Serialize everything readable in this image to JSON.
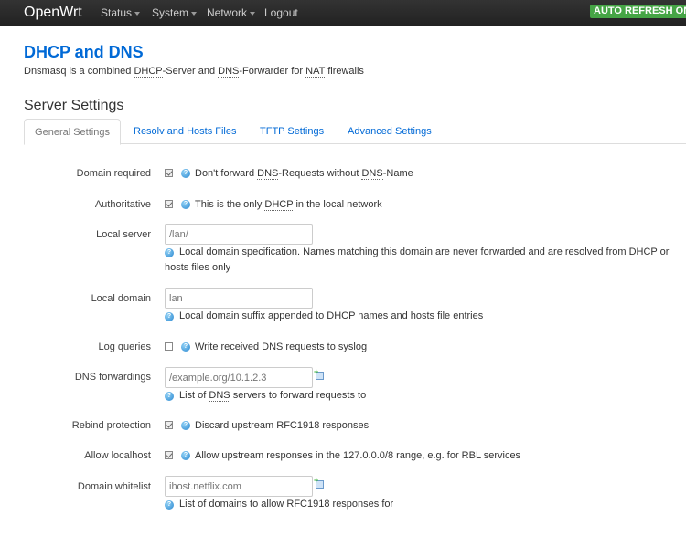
{
  "navbar": {
    "brand": "OpenWrt",
    "menu": [
      {
        "label": "Status",
        "dropdown": true
      },
      {
        "label": "System",
        "dropdown": true
      },
      {
        "label": "Network",
        "dropdown": true
      },
      {
        "label": "Logout",
        "dropdown": false
      }
    ],
    "badge": "AUTO REFRESH ON",
    "badge_color": "#46a546"
  },
  "page": {
    "title": "DHCP and DNS",
    "desc_parts": [
      "Dnsmasq is a combined ",
      "DHCP",
      "-Server and ",
      "DNS",
      "-Forwarder for ",
      "NAT",
      " firewalls"
    ],
    "section_title": "Server Settings"
  },
  "tabs": [
    {
      "label": "General Settings",
      "active": true
    },
    {
      "label": "Resolv and Hosts Files",
      "active": false
    },
    {
      "label": "TFTP Settings",
      "active": false
    },
    {
      "label": "Advanced Settings",
      "active": false
    }
  ],
  "fields": {
    "domain_required": {
      "label": "Domain required",
      "checked": true,
      "desc_parts": [
        "Don't forward ",
        "DNS",
        "-Requests without ",
        "DNS",
        "-Name"
      ]
    },
    "authoritative": {
      "label": "Authoritative",
      "checked": true,
      "desc_parts": [
        "This is the only ",
        "DHCP",
        " in the local network"
      ]
    },
    "local_server": {
      "label": "Local server",
      "placeholder": "/lan/",
      "value": "",
      "desc": "Local domain specification. Names matching this domain are never forwarded and are resolved from DHCP or hosts files only"
    },
    "local_domain": {
      "label": "Local domain",
      "placeholder": "lan",
      "value": "",
      "desc": "Local domain suffix appended to DHCP names and hosts file entries"
    },
    "log_queries": {
      "label": "Log queries",
      "checked": false,
      "desc": "Write received DNS requests to syslog"
    },
    "dns_forwardings": {
      "label": "DNS forwardings",
      "placeholder": "/example.org/10.1.2.3",
      "value": "",
      "desc_parts": [
        "List of ",
        "DNS",
        " servers to forward requests to"
      ]
    },
    "rebind_protection": {
      "label": "Rebind protection",
      "checked": true,
      "desc": "Discard upstream RFC1918 responses"
    },
    "allow_localhost": {
      "label": "Allow localhost",
      "checked": true,
      "desc": "Allow upstream responses in the 127.0.0.0/8 range, e.g. for RBL services"
    },
    "domain_whitelist": {
      "label": "Domain whitelist",
      "placeholder": "ihost.netflix.com",
      "value": "",
      "desc": "List of domains to allow RFC1918 responses for"
    }
  },
  "icons": {
    "info": "help-icon",
    "add": "add-entry-icon"
  }
}
